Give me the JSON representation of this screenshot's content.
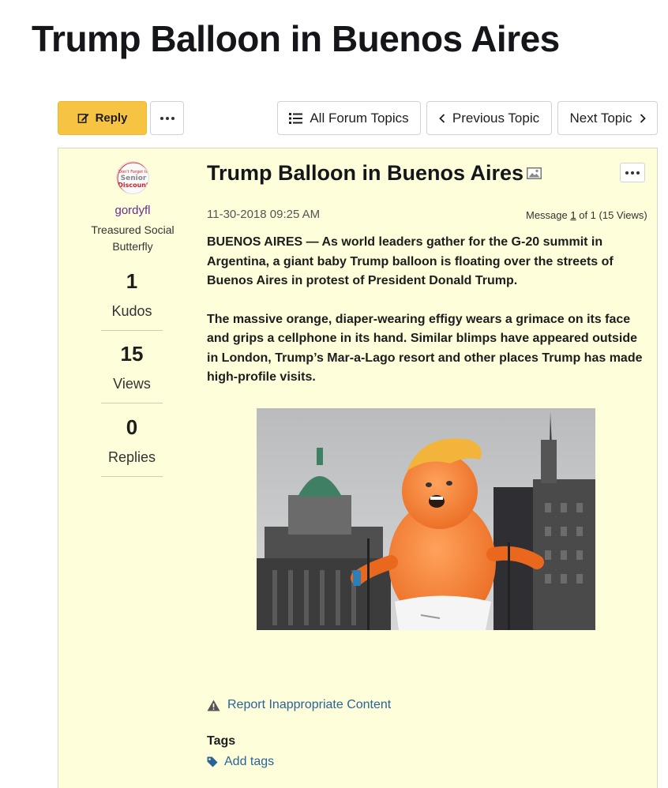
{
  "page": {
    "title": "Trump Balloon in Buenos Aires"
  },
  "toolbar": {
    "reply_label": "Reply",
    "all_topics_label": "All Forum Topics",
    "prev_label": "Previous Topic",
    "next_label": "Next Topic"
  },
  "author": {
    "avatar_text": [
      "Don't Forget to",
      "Senior",
      "Discount"
    ],
    "username": "gordyfl",
    "rank": "Treasured Social Butterfly",
    "stats": [
      {
        "value": "1",
        "label": "Kudos"
      },
      {
        "value": "15",
        "label": "Views"
      },
      {
        "value": "0",
        "label": "Replies"
      }
    ]
  },
  "post": {
    "title": "Trump Balloon in Buenos Aires",
    "date": "11-30-2018 09:25 AM",
    "meta_prefix": "Message ",
    "meta_index": "1",
    "meta_suffix": " of 1 (15 Views)",
    "paragraphs": [
      "BUENOS AIRES — As world leaders gather for the G-20 summit in Argentina, a giant baby Trump balloon is floating over the streets of Buenos Aires in protest of President Donald Trump.",
      "The massive orange, diaper-wearing effigy wears a grimace on its face and grips a cellphone in its hand. Similar blimps have appeared outside in London, Trump’s Mar-a-Lago resort and other places Trump has made high-profile visits."
    ]
  },
  "footer": {
    "report_label": "Report Inappropriate Content",
    "tags_heading": "Tags",
    "add_tags_label": "Add tags"
  },
  "colors": {
    "accent": "#f6c343",
    "post_bg": "#fefedb",
    "link": "#2a6496",
    "username": "#6a2c8e"
  }
}
